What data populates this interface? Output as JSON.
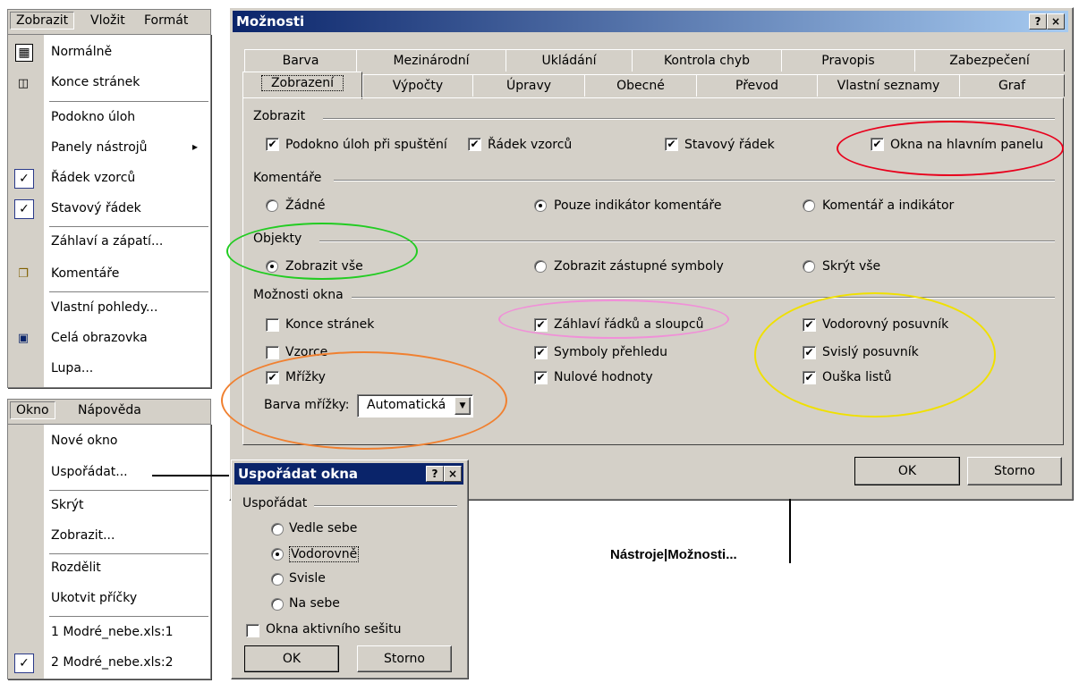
{
  "view_menu": {
    "menubar": [
      "Zobrazit",
      "Vložit",
      "Formát"
    ],
    "items": [
      {
        "label": "Normálně",
        "icon": "normal-view-icon"
      },
      {
        "label": "Konce stránek",
        "icon": "page-break-icon"
      },
      {
        "label": "Podokno úloh"
      },
      {
        "label": "Panely nástrojů",
        "submenu_arrow": "▸"
      },
      {
        "label": "Řádek vzorců",
        "check": "✓"
      },
      {
        "label": "Stavový řádek",
        "check": "✓"
      },
      {
        "label": "Záhlaví a zápatí..."
      },
      {
        "label": "Komentáře",
        "icon": "comments-icon"
      },
      {
        "label": "Vlastní pohledy..."
      },
      {
        "label": "Celá obrazovka",
        "icon": "fullscreen-icon"
      },
      {
        "label": "Lupa..."
      }
    ]
  },
  "window_menu": {
    "menubar": [
      "Okno",
      "Nápověda"
    ],
    "items": [
      {
        "label": "Nové okno"
      },
      {
        "label": "Uspořádat..."
      },
      {
        "label": "Skrýt"
      },
      {
        "label": "Zobrazit..."
      },
      {
        "label": "Rozdělit"
      },
      {
        "label": "Ukotvit příčky"
      },
      {
        "label": "1 Modré_nebe.xls:1"
      },
      {
        "label": "2 Modré_nebe.xls:2",
        "check": "✓"
      }
    ]
  },
  "options_dialog": {
    "title": "Možnosti",
    "help_btn": "?",
    "close_btn": "×",
    "tabs_back": [
      "Barva",
      "Mezinárodní",
      "Ukládání",
      "Kontrola chyb",
      "Pravopis",
      "Zabezpečení"
    ],
    "tabs_front": [
      "Zobrazení",
      "Výpočty",
      "Úpravy",
      "Obecné",
      "Převod",
      "Vlastní seznamy",
      "Graf"
    ],
    "group_show": "Zobrazit",
    "show_items": [
      {
        "label": "Podokno úloh při spuštění",
        "checked": true
      },
      {
        "label": "Řádek vzorců",
        "checked": true
      },
      {
        "label": "Stavový řádek",
        "checked": true
      },
      {
        "label": "Okna na hlavním panelu",
        "checked": true
      }
    ],
    "group_comments": "Komentáře",
    "comment_items": [
      {
        "label": "Žádné",
        "selected": false
      },
      {
        "label": "Pouze indikátor komentáře",
        "selected": true
      },
      {
        "label": "Komentář a indikátor",
        "selected": false
      }
    ],
    "group_objects": "Objekty",
    "object_items": [
      {
        "label": "Zobrazit vše",
        "selected": true
      },
      {
        "label": "Zobrazit zástupné symboly",
        "selected": false
      },
      {
        "label": "Skrýt vše",
        "selected": false
      }
    ],
    "group_window": "Možnosti okna",
    "window_items": [
      {
        "label": "Konce stránek",
        "checked": false
      },
      {
        "label": "Vzorce",
        "checked": false
      },
      {
        "label": "Mřížky",
        "checked": true
      },
      {
        "label": "Záhlaví řádků a sloupců",
        "checked": true
      },
      {
        "label": "Symboly přehledu",
        "checked": true
      },
      {
        "label": "Nulové hodnoty",
        "checked": true
      },
      {
        "label": "Vodorovný posuvník",
        "checked": true
      },
      {
        "label": "Svislý posuvník",
        "checked": true
      },
      {
        "label": "Ouška listů",
        "checked": true
      }
    ],
    "grid_color_label": "Barva mřížky:",
    "grid_color_value": "Automatická",
    "ok": "OK",
    "cancel": "Storno"
  },
  "arrange_dialog": {
    "title": "Uspořádat okna",
    "help_btn": "?",
    "close_btn": "×",
    "group": "Uspořádat",
    "options": [
      {
        "label": "Vedle sebe",
        "selected": false
      },
      {
        "label": "Vodorovně",
        "selected": true
      },
      {
        "label": "Svisle",
        "selected": false
      },
      {
        "label": "Na sebe",
        "selected": false
      }
    ],
    "active_only": {
      "label": "Okna aktivního sešitu",
      "checked": false
    },
    "ok": "OK",
    "cancel": "Storno"
  },
  "caption": "Nástroje|Možnosti...",
  "highlight_colors": {
    "red": "#e8001c",
    "green": "#22cc22",
    "pink": "#f090d8",
    "yellow": "#f0e000",
    "orange": "#f08030"
  }
}
